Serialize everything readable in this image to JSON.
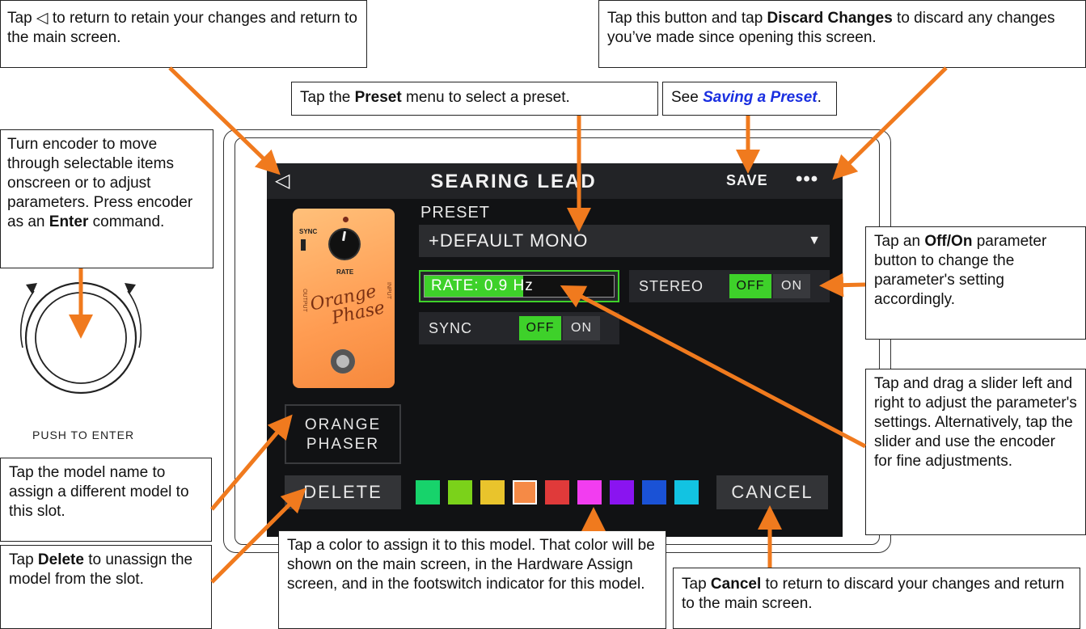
{
  "callouts": {
    "back": {
      "pre": "Tap ",
      "icon": "◁",
      "post": " to return to retain your changes and return to the main screen."
    },
    "discard": {
      "pre": "Tap this button and tap ",
      "bold": "Discard Changes",
      "post": " to discard any changes you’ve made since opening this screen."
    },
    "preset": {
      "pre": "Tap the ",
      "bold": "Preset",
      "post": " menu to select a preset."
    },
    "save": {
      "pre": "See ",
      "link": "Saving a Preset",
      "post": "."
    },
    "encoder": {
      "pre": "Turn encoder to move through selectable items onscreen or to adjust parameters. Press encoder as an ",
      "bold": "Enter",
      "post": " command."
    },
    "onoff": {
      "pre": "Tap an ",
      "bold": "Off/On",
      "post": " parameter button to change the parameter's setting accordingly."
    },
    "slider": {
      "text": "Tap and drag a slider left and right to adjust the parameter's settings. Alternatively, tap the slider and use the encoder for fine adjustments."
    },
    "model": {
      "text": "Tap the model name to assign a different model to this slot."
    },
    "delete": {
      "pre": "Tap ",
      "bold": "Delete",
      "post": " to unassign the model from the slot."
    },
    "color": {
      "text": "Tap a color to assign it to this model. That color will be shown on the main screen, in the Hardware Assign screen, and in the footswitch indicator for this model."
    },
    "cancel": {
      "pre": "Tap ",
      "bold": "Cancel",
      "post": " to return to discard your changes and return to the main screen."
    }
  },
  "encoder_label": "PUSH TO ENTER",
  "screen": {
    "back_icon": "◁",
    "title": "SEARING LEAD",
    "save_label": "SAVE",
    "more_label": "•••",
    "pedal": {
      "sync_label": "SYNC",
      "rate_label": "RATE",
      "output_label": "OUTPUT",
      "input_label": "INPUT",
      "script_line1": "Orange",
      "script_line2": "Phase"
    },
    "model_name_line1": "ORANGE",
    "model_name_line2": "PHASER",
    "preset_label": "PRESET",
    "preset_value": "+DEFAULT MONO",
    "preset_caret": "▼",
    "rate": {
      "text": "RATE: 0.9 Hz",
      "fill_fraction": 0.52
    },
    "stereo": {
      "label": "STEREO",
      "off": "OFF",
      "on": "ON",
      "active": "off"
    },
    "sync": {
      "label": "SYNC",
      "off": "OFF",
      "on": "ON",
      "active": "off"
    },
    "delete_label": "DELETE",
    "cancel_label": "CANCEL",
    "colors": [
      "#17d36b",
      "#7bd21a",
      "#e9c42c",
      "#f58a46",
      "#e03a3a",
      "#f23df0",
      "#8a14f0",
      "#1a52d6",
      "#12c3e2"
    ],
    "selected_color_index": 3
  },
  "accent_color": "#f07a1e"
}
